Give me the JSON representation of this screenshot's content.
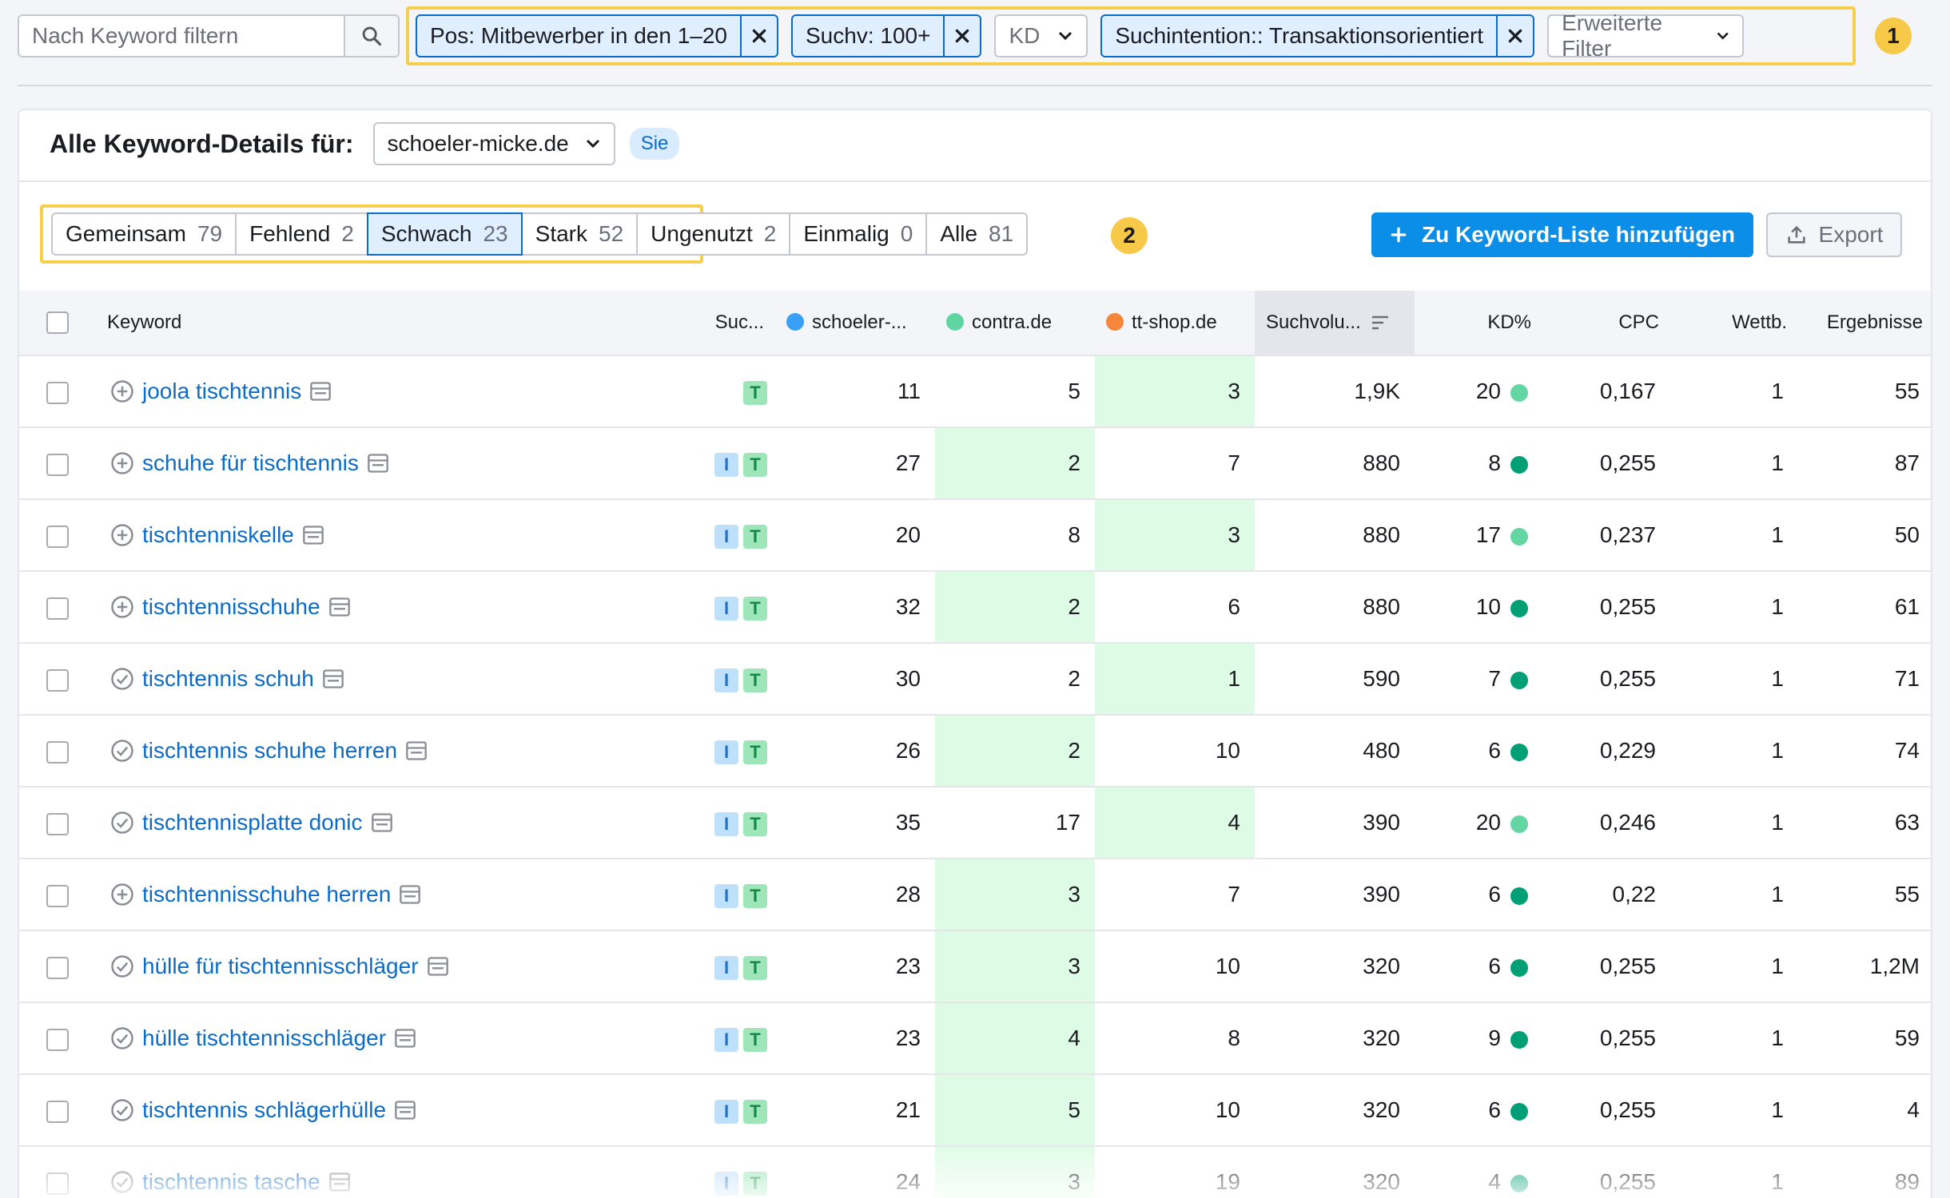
{
  "search": {
    "placeholder": "Nach Keyword filtern"
  },
  "filters": {
    "position": "Pos: Mitbewerber in den 1–20",
    "volume": "Suchv: 100+",
    "kd": "KD",
    "intent": "Suchintention:: Transaktionsorientiert",
    "advanced": "Erweiterte Filter"
  },
  "annotations": {
    "one": "1",
    "two": "2"
  },
  "header": {
    "title": "Alle Keyword-Details für:",
    "domain": "schoeler-micke.de",
    "you_badge": "Sie"
  },
  "tabs": [
    {
      "label": "Gemeinsam",
      "count": "79"
    },
    {
      "label": "Fehlend",
      "count": "2"
    },
    {
      "label": "Schwach",
      "count": "23"
    },
    {
      "label": "Stark",
      "count": "52"
    },
    {
      "label": "Ungenutzt",
      "count": "2"
    },
    {
      "label": "Einmalig",
      "count": "0"
    },
    {
      "label": "Alle",
      "count": "81"
    }
  ],
  "actions": {
    "add_to_list": "Zu Keyword-Liste hinzufügen",
    "export": "Export"
  },
  "colors": {
    "schoeler": "#3aa0f5",
    "contra": "#5fd6a2",
    "ttshop": "#f5863b",
    "kd_light": "#63d6a2",
    "kd_dark": "#009f76"
  },
  "table": {
    "columns": {
      "keyword": "Keyword",
      "intent": "Suc...",
      "schoeler": "schoeler-...",
      "contra": "contra.de",
      "ttshop": "tt-shop.de",
      "volume": "Suchvolu...",
      "kd": "KD%",
      "cpc": "CPC",
      "competition": "Wettb.",
      "results": "Ergebnisse"
    },
    "rows": [
      {
        "keyword": "joola tischtennis",
        "status": "add",
        "intents": [
          "T"
        ],
        "schoeler": "11",
        "contra": "5",
        "ttshop": "3",
        "best": "ttshop",
        "volume": "1,9K",
        "kd": "20",
        "kd_color": "light",
        "cpc": "0,167",
        "competition": "1",
        "results": "55"
      },
      {
        "keyword": "schuhe für tischtennis",
        "status": "add",
        "intents": [
          "I",
          "T"
        ],
        "schoeler": "27",
        "contra": "2",
        "ttshop": "7",
        "best": "contra",
        "volume": "880",
        "kd": "8",
        "kd_color": "dark",
        "cpc": "0,255",
        "competition": "1",
        "results": "87"
      },
      {
        "keyword": "tischtenniskelle",
        "status": "add",
        "intents": [
          "I",
          "T"
        ],
        "schoeler": "20",
        "contra": "8",
        "ttshop": "3",
        "best": "ttshop",
        "volume": "880",
        "kd": "17",
        "kd_color": "light",
        "cpc": "0,237",
        "competition": "1",
        "results": "50"
      },
      {
        "keyword": "tischtennisschuhe",
        "status": "add",
        "intents": [
          "I",
          "T"
        ],
        "schoeler": "32",
        "contra": "2",
        "ttshop": "6",
        "best": "contra",
        "volume": "880",
        "kd": "10",
        "kd_color": "dark",
        "cpc": "0,255",
        "competition": "1",
        "results": "61"
      },
      {
        "keyword": "tischtennis schuh",
        "status": "check",
        "intents": [
          "I",
          "T"
        ],
        "schoeler": "30",
        "contra": "2",
        "ttshop": "1",
        "best": "ttshop",
        "volume": "590",
        "kd": "7",
        "kd_color": "dark",
        "cpc": "0,255",
        "competition": "1",
        "results": "71"
      },
      {
        "keyword": "tischtennis schuhe herren",
        "status": "check",
        "intents": [
          "I",
          "T"
        ],
        "schoeler": "26",
        "contra": "2",
        "ttshop": "10",
        "best": "contra",
        "volume": "480",
        "kd": "6",
        "kd_color": "dark",
        "cpc": "0,229",
        "competition": "1",
        "results": "74"
      },
      {
        "keyword": "tischtennisplatte donic",
        "status": "check",
        "intents": [
          "I",
          "T"
        ],
        "schoeler": "35",
        "contra": "17",
        "ttshop": "4",
        "best": "ttshop",
        "volume": "390",
        "kd": "20",
        "kd_color": "light",
        "cpc": "0,246",
        "competition": "1",
        "results": "63"
      },
      {
        "keyword": "tischtennisschuhe herren",
        "status": "add",
        "intents": [
          "I",
          "T"
        ],
        "schoeler": "28",
        "contra": "3",
        "ttshop": "7",
        "best": "contra",
        "volume": "390",
        "kd": "6",
        "kd_color": "dark",
        "cpc": "0,22",
        "competition": "1",
        "results": "55"
      },
      {
        "keyword": "hülle für tischtennisschläger",
        "status": "check",
        "intents": [
          "I",
          "T"
        ],
        "schoeler": "23",
        "contra": "3",
        "ttshop": "10",
        "best": "contra",
        "volume": "320",
        "kd": "6",
        "kd_color": "dark",
        "cpc": "0,255",
        "competition": "1",
        "results": "1,2M"
      },
      {
        "keyword": "hülle tischtennisschläger",
        "status": "check",
        "intents": [
          "I",
          "T"
        ],
        "schoeler": "23",
        "contra": "4",
        "ttshop": "8",
        "best": "contra",
        "volume": "320",
        "kd": "9",
        "kd_color": "dark",
        "cpc": "0,255",
        "competition": "1",
        "results": "59"
      },
      {
        "keyword": "tischtennis schlägerhülle",
        "status": "check",
        "intents": [
          "I",
          "T"
        ],
        "schoeler": "21",
        "contra": "5",
        "ttshop": "10",
        "best": "contra",
        "volume": "320",
        "kd": "6",
        "kd_color": "dark",
        "cpc": "0,255",
        "competition": "1",
        "results": "4"
      },
      {
        "keyword": "tischtennis tasche",
        "status": "check",
        "intents": [
          "I",
          "T"
        ],
        "schoeler": "24",
        "contra": "3",
        "ttshop": "19",
        "best": "contra",
        "volume": "320",
        "kd": "4",
        "kd_color": "dark",
        "cpc": "0,255",
        "competition": "1",
        "results": "89"
      }
    ]
  }
}
